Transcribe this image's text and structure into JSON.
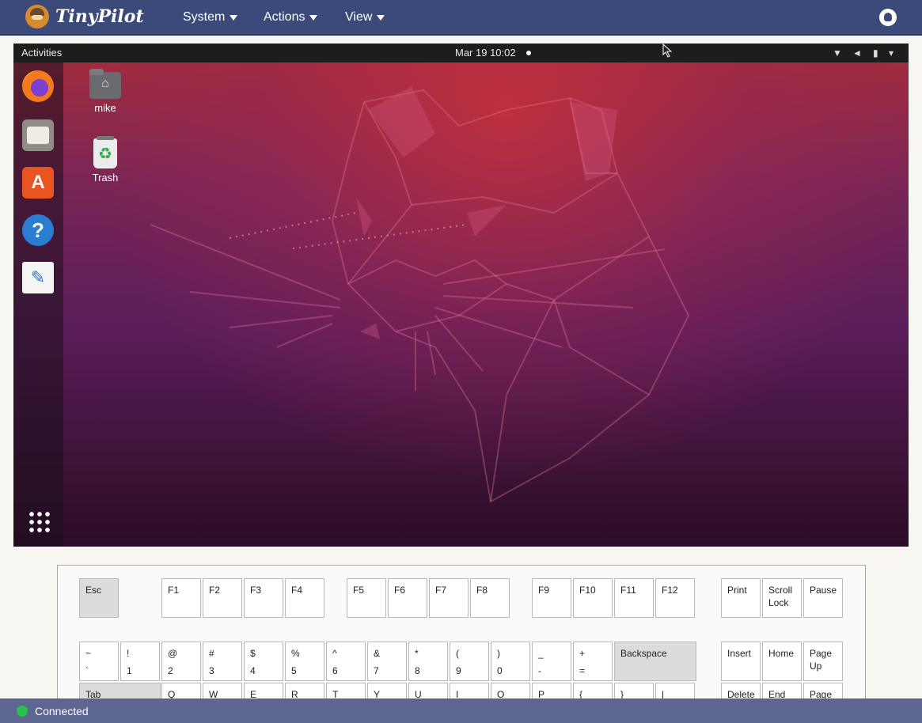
{
  "app": {
    "name": "TinyPilot",
    "menus": [
      {
        "label": "System"
      },
      {
        "label": "Actions"
      },
      {
        "label": "View"
      }
    ],
    "github_icon": "github-icon"
  },
  "remote_screen": {
    "top_bar": {
      "activities": "Activities",
      "clock": "Mar 19  10:02",
      "tray_icons": [
        "wifi-icon",
        "volume-icon",
        "battery-icon",
        "system-menu-icon"
      ]
    },
    "dock": [
      "firefox-icon",
      "files-icon",
      "software-icon",
      "help-icon",
      "text-editor-icon",
      "show-apps-icon"
    ],
    "desktop_icons": [
      {
        "label": "mike",
        "icon": "home-folder-icon"
      },
      {
        "label": "Trash",
        "icon": "trash-icon"
      }
    ]
  },
  "keyboard": {
    "row1": [
      {
        "id": "esc",
        "top": "Esc",
        "bottom": ""
      },
      {
        "id": "f1",
        "top": "F1",
        "bottom": ""
      },
      {
        "id": "f2",
        "top": "F2",
        "bottom": ""
      },
      {
        "id": "f3",
        "top": "F3",
        "bottom": ""
      },
      {
        "id": "f4",
        "top": "F4",
        "bottom": ""
      },
      {
        "id": "f5",
        "top": "F5",
        "bottom": ""
      },
      {
        "id": "f6",
        "top": "F6",
        "bottom": ""
      },
      {
        "id": "f7",
        "top": "F7",
        "bottom": ""
      },
      {
        "id": "f8",
        "top": "F8",
        "bottom": ""
      },
      {
        "id": "f9",
        "top": "F9",
        "bottom": ""
      },
      {
        "id": "f10",
        "top": "F10",
        "bottom": ""
      },
      {
        "id": "f11",
        "top": "F11",
        "bottom": ""
      },
      {
        "id": "f12",
        "top": "F12",
        "bottom": ""
      },
      {
        "id": "print",
        "top": "Print",
        "bottom": ""
      },
      {
        "id": "scroll-lock",
        "top": "Scroll",
        "bottom": "Lock"
      },
      {
        "id": "pause",
        "top": "Pause",
        "bottom": ""
      }
    ],
    "row2": [
      {
        "id": "backtick",
        "top": "~",
        "bottom": "`"
      },
      {
        "id": "1",
        "top": "!",
        "bottom": "1"
      },
      {
        "id": "2",
        "top": "@",
        "bottom": "2"
      },
      {
        "id": "3",
        "top": "#",
        "bottom": "3"
      },
      {
        "id": "4",
        "top": "$",
        "bottom": "4"
      },
      {
        "id": "5",
        "top": "%",
        "bottom": "5"
      },
      {
        "id": "6",
        "top": "^",
        "bottom": "6"
      },
      {
        "id": "7",
        "top": "&",
        "bottom": "7"
      },
      {
        "id": "8",
        "top": "*",
        "bottom": "8"
      },
      {
        "id": "9",
        "top": "(",
        "bottom": "9"
      },
      {
        "id": "0",
        "top": ")",
        "bottom": "0"
      },
      {
        "id": "minus",
        "top": "_",
        "bottom": "-"
      },
      {
        "id": "equals",
        "top": "+",
        "bottom": "="
      },
      {
        "id": "backspace",
        "top": "Backspace",
        "bottom": ""
      },
      {
        "id": "insert",
        "top": "Insert",
        "bottom": ""
      },
      {
        "id": "home",
        "top": "Home",
        "bottom": ""
      },
      {
        "id": "page-up",
        "top": "Page",
        "bottom": "Up"
      }
    ],
    "row3": [
      {
        "id": "tab",
        "top": "Tab",
        "bottom": ""
      },
      {
        "id": "q",
        "top": "Q",
        "bottom": ""
      },
      {
        "id": "w",
        "top": "W",
        "bottom": ""
      },
      {
        "id": "e",
        "top": "E",
        "bottom": ""
      },
      {
        "id": "r",
        "top": "R",
        "bottom": ""
      },
      {
        "id": "t",
        "top": "T",
        "bottom": ""
      },
      {
        "id": "y",
        "top": "Y",
        "bottom": ""
      },
      {
        "id": "u",
        "top": "U",
        "bottom": ""
      },
      {
        "id": "i",
        "top": "I",
        "bottom": ""
      },
      {
        "id": "o",
        "top": "O",
        "bottom": ""
      },
      {
        "id": "p",
        "top": "P",
        "bottom": ""
      },
      {
        "id": "lbrace",
        "top": "{",
        "bottom": ""
      },
      {
        "id": "rbrace",
        "top": "}",
        "bottom": ""
      },
      {
        "id": "pipe",
        "top": "|",
        "bottom": ""
      },
      {
        "id": "delete",
        "top": "Delete",
        "bottom": ""
      },
      {
        "id": "end",
        "top": "End",
        "bottom": ""
      },
      {
        "id": "page-down",
        "top": "Page",
        "bottom": ""
      }
    ]
  },
  "status": {
    "text": "Connected",
    "color": "#27c24c"
  }
}
